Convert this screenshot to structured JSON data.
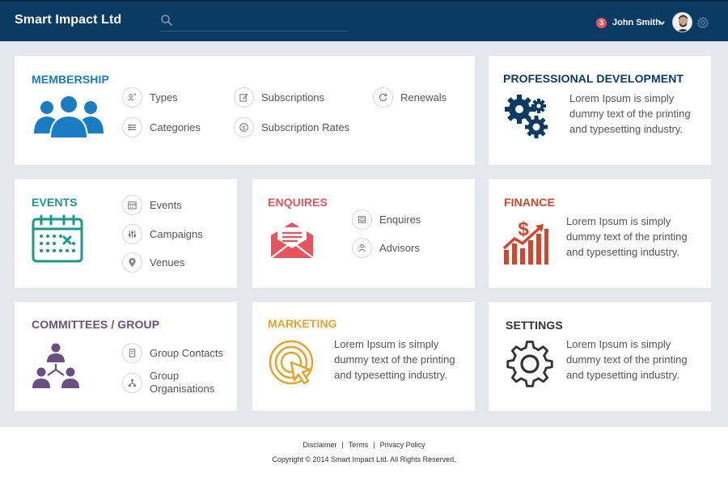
{
  "header": {
    "brand": "Smart Impact Ltd",
    "search_placeholder": "",
    "notification_count": "3",
    "user_name": "John Smith"
  },
  "colors": {
    "header_bg": "#0b3a63",
    "membership": "#1a7dc4",
    "professional": "#0b3a63",
    "events": "#1a9a8a",
    "enquires": "#e8545e",
    "finance": "#d9432a",
    "committees": "#6b4f80",
    "marketing": "#e3a52a",
    "settings": "#333333"
  },
  "membership": {
    "title": "MEMBERSHIP",
    "links": [
      {
        "label": "Types",
        "icon": "user-tag-icon"
      },
      {
        "label": "Subscriptions",
        "icon": "edit-document-icon"
      },
      {
        "label": "Renewals",
        "icon": "refresh-icon"
      },
      {
        "label": "Categories",
        "icon": "list-icon"
      },
      {
        "label": "Subscription Rates",
        "icon": "dollar-icon"
      }
    ]
  },
  "professional": {
    "title": "PROFESSIONAL DEVELOPMENT",
    "desc": "Lorem Ipsum is simply dummy text of the printing and typesetting industry."
  },
  "events": {
    "title": "EVENTS",
    "links": [
      {
        "label": "Events",
        "icon": "calendar-icon"
      },
      {
        "label": "Campaigns",
        "icon": "sliders-icon"
      },
      {
        "label": "Venues",
        "icon": "map-pin-icon"
      }
    ]
  },
  "enquires": {
    "title": "ENQUIRES",
    "links": [
      {
        "label": "Enquires",
        "icon": "inbox-icon"
      },
      {
        "label": "Advisors",
        "icon": "advisor-icon"
      }
    ]
  },
  "finance": {
    "title": "FINANCE",
    "desc": "Lorem Ipsum is simply dummy text of the printing and typesetting industry."
  },
  "committees": {
    "title": "COMMITTEES / GROUP",
    "links": [
      {
        "label": "Group Contacts",
        "icon": "contact-card-icon"
      },
      {
        "label": "Group Organisations",
        "icon": "org-tree-icon"
      }
    ]
  },
  "marketing": {
    "title": "MARKETING",
    "desc": "Lorem Ipsum is simply dummy text of the printing and typesetting industry."
  },
  "settings": {
    "title": "SETTINGS",
    "desc": "Lorem Ipsum is simply dummy text of the printing and typesetting industry."
  },
  "footer": {
    "disclaimer": "Disclaimer",
    "terms": "Terms",
    "privacy": "Privacy Policy",
    "separator": "|",
    "copyright": "Copyright © 2014 Smart Impact Ltd. All Rights Reserved."
  }
}
